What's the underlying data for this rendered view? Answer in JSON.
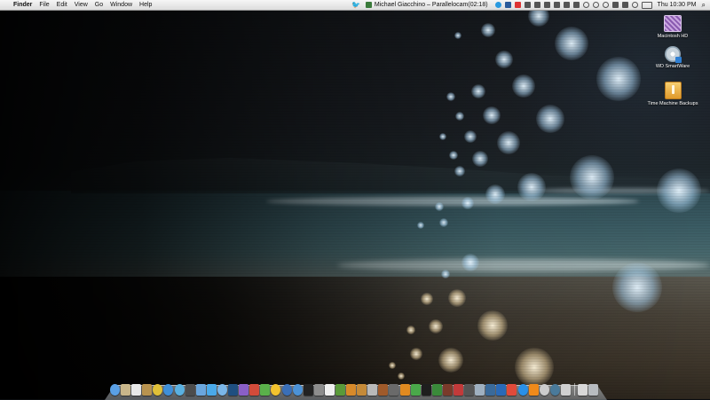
{
  "menubar": {
    "apple_glyph": "",
    "app_name": "Finder",
    "menus": [
      "File",
      "Edit",
      "View",
      "Go",
      "Window",
      "Help"
    ],
    "now_playing": "Michael Giacchino – Parallelocam(02:18)",
    "clock": "Thu 10:30 PM",
    "spotlight_glyph": "⌕",
    "twitter_glyph": "🐦"
  },
  "desktop_icons": [
    {
      "label": "Macintosh HD"
    },
    {
      "label": "WD SmartWare"
    },
    {
      "label": "Time Machine Backups"
    }
  ],
  "dock": {
    "apps": [
      {
        "name": "finder-icon",
        "color": "#5aa0e6"
      },
      {
        "name": "preview-icon",
        "color": "#c9b68a"
      },
      {
        "name": "ical-icon",
        "color": "#e8e8e8"
      },
      {
        "name": "address-book-icon",
        "color": "#b8934f"
      },
      {
        "name": "chrome-icon",
        "color": "#e0c038"
      },
      {
        "name": "safari-icon",
        "color": "#3f8fd8"
      },
      {
        "name": "itunes-icon",
        "color": "#5ab0e0"
      },
      {
        "name": "tweetdeck-icon",
        "color": "#4c4c4c"
      },
      {
        "name": "mail-icon",
        "color": "#6aa6dd"
      },
      {
        "name": "twitter-icon",
        "color": "#4aa9e8"
      },
      {
        "name": "skype-icon",
        "color": "#7ab6e8"
      },
      {
        "name": "photoshop-icon",
        "color": "#1f4f80"
      },
      {
        "name": "itunes-store-icon",
        "color": "#8a5fc6"
      },
      {
        "name": "contacts-icon",
        "color": "#d24b3a"
      },
      {
        "name": "adium-icon",
        "color": "#5ab04a"
      },
      {
        "name": "smiley-icon",
        "color": "#f2c22e"
      },
      {
        "name": "dashboard-icon",
        "color": "#3a6fb8"
      },
      {
        "name": "ichat-icon",
        "color": "#4c92d6"
      },
      {
        "name": "photo-booth-icon",
        "color": "#222222"
      },
      {
        "name": "system-prefs-icon",
        "color": "#8d8d8d"
      },
      {
        "name": "textedit-icon",
        "color": "#f0f0f0"
      },
      {
        "name": "coda-icon",
        "color": "#5a9a3a"
      },
      {
        "name": "transmit-icon",
        "color": "#d88a2a"
      },
      {
        "name": "iphoto-icon",
        "color": "#c58a38"
      },
      {
        "name": "automator-icon",
        "color": "#b9b9b9"
      },
      {
        "name": "guitar-icon",
        "color": "#a05a2a"
      },
      {
        "name": "imovie-icon",
        "color": "#6a6a6a"
      },
      {
        "name": "vlc-icon",
        "color": "#e08a20"
      },
      {
        "name": "utorrent-icon",
        "color": "#4aa84a"
      },
      {
        "name": "terminal-icon",
        "color": "#1e1e1e"
      },
      {
        "name": "activity-monitor-icon",
        "color": "#3a8a3a"
      },
      {
        "name": "dictionary-icon",
        "color": "#7a3a2a"
      },
      {
        "name": "growl-icon",
        "color": "#c23a3a"
      },
      {
        "name": "eye-icon",
        "color": "#555555"
      },
      {
        "name": "mirror-icon",
        "color": "#9fb0c0"
      },
      {
        "name": "python-icon",
        "color": "#3a6a9a"
      },
      {
        "name": "xcode-icon",
        "color": "#2a6ab8"
      },
      {
        "name": "flag-icon",
        "color": "#e04a3a"
      },
      {
        "name": "app-store-icon",
        "color": "#2a90e8"
      },
      {
        "name": "cone-icon",
        "color": "#f08a1a"
      },
      {
        "name": "dvd-icon",
        "color": "#cccccc"
      },
      {
        "name": "time-machine-icon",
        "color": "#4a7a9a"
      },
      {
        "name": "screen-sharing-icon",
        "color": "#d0d0d0"
      }
    ],
    "others": [
      {
        "name": "downloads-stack-icon",
        "color": "#d8d8d8"
      },
      {
        "name": "trash-icon",
        "color": "#b8bcc0"
      }
    ]
  },
  "colors": {
    "menubar_bg": "#dcdcdc",
    "wallpaper_sea": "#3a5b63",
    "wallpaper_sand": "#4a443a"
  }
}
